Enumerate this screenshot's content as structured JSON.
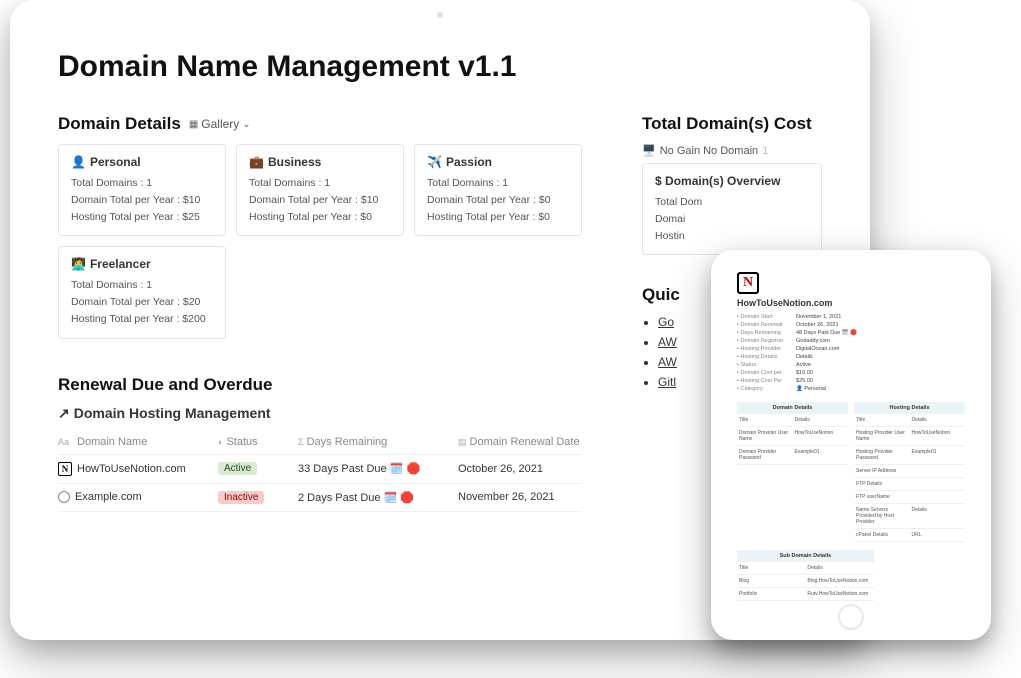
{
  "page": {
    "title": "Domain Name Management v1.1"
  },
  "domain_details": {
    "heading": "Domain Details",
    "view_label": "Gallery",
    "cards": [
      {
        "icon": "👤",
        "title": "Personal",
        "total_domains": "Total Domains : 1",
        "domain_total": "Domain Total per Year : $10",
        "hosting_total": "Hosting Total per Year : $25"
      },
      {
        "icon": "💼",
        "title": "Business",
        "total_domains": "Total Domains : 1",
        "domain_total": "Domain Total per Year : $10",
        "hosting_total": "Hosting Total per Year : $0"
      },
      {
        "icon": "✈️",
        "title": "Passion",
        "total_domains": "Total Domains : 1",
        "domain_total": "Domain Total per Year : $0",
        "hosting_total": "Hosting Total per Year : $0"
      },
      {
        "icon": "🧑‍💻",
        "title": "Freelancer",
        "total_domains": "Total Domains : 1",
        "domain_total": "Domain Total per Year : $20",
        "hosting_total": "Hosting Total per Year : $200"
      }
    ]
  },
  "renewal": {
    "heading": "Renewal Due and Overdue",
    "subheading": "Domain Hosting Management",
    "columns": {
      "name": "Domain Name",
      "status": "Status",
      "days": "Days Remaining",
      "date": "Domain Renewal Date"
    },
    "rows": [
      {
        "icon_type": "notion",
        "name": "HowToUseNotion.com",
        "status": "Active",
        "status_class": "badge-active",
        "days": "33 Days Past Due 🗓️ 🛑",
        "date": "October 26, 2021"
      },
      {
        "icon_type": "globe",
        "name": "Example.com",
        "status": "Inactive",
        "status_class": "badge-inactive",
        "days": "2 Days Past Due 🗓️ 🛑",
        "date": "November 26, 2021"
      }
    ]
  },
  "cost": {
    "heading": "Total Domain(s) Cost",
    "pill": "No Gain No Domain",
    "pill_count": "1",
    "overview_title": "Domain(s) Overview",
    "lines": [
      "Total Dom",
      "Domai",
      "Hostin"
    ]
  },
  "quick": {
    "heading": "Quic",
    "links": [
      "Go",
      "AW",
      "AW",
      "Gitl"
    ]
  },
  "tablet": {
    "title": "HowToUseNotion.com",
    "props": [
      {
        "label": "Domain Start",
        "value": "November 1, 2021"
      },
      {
        "label": "Domain Renewal",
        "value": "October 26, 2021"
      },
      {
        "label": "Days Remaining",
        "value": "48 Days Past Due 🗓️ 🛑"
      },
      {
        "label": "Domain Registrar",
        "value": "Godaddy.com"
      },
      {
        "label": "Hosting Provider",
        "value": "DigitalOcean.com"
      },
      {
        "label": "Hosting Details",
        "value": "Details"
      },
      {
        "label": "Status",
        "value": "Active"
      },
      {
        "label": "Domain Cost per",
        "value": "$10.00"
      },
      {
        "label": "Hosting Cost Per",
        "value": "$25.00"
      },
      {
        "label": "Category",
        "value": "👤 Personal"
      }
    ],
    "domain_table": {
      "header": "Domain Details",
      "rows": [
        {
          "k": "Title",
          "v": "Details"
        },
        {
          "k": "Domain Provider User Name",
          "v": "HowToUseNotion"
        },
        {
          "k": "Domain Provider Password",
          "v": "Example01"
        }
      ]
    },
    "hosting_table": {
      "header": "Hosting Details",
      "rows": [
        {
          "k": "Title",
          "v": "Details"
        },
        {
          "k": "Hosting Provider User Name",
          "v": "HowToUseNotion"
        },
        {
          "k": "Hosting Provider Password",
          "v": "Example01"
        },
        {
          "k": "Server IP Address",
          "v": ""
        },
        {
          "k": "FTP Details",
          "v": ""
        },
        {
          "k": "FTP userName",
          "v": ""
        },
        {
          "k": "Name Servers Provided by Host Provider",
          "v": "Details"
        },
        {
          "k": "cPanel Details",
          "v": "URL"
        }
      ]
    },
    "sub_table": {
      "header": "Sub Domain Details",
      "rows": [
        {
          "k": "Title",
          "v": "Details"
        },
        {
          "k": "Blog",
          "v": "Blog.HowToUseNotion.com"
        },
        {
          "k": "Portfolio",
          "v": "Rutv.HowToUseNotion.com"
        }
      ]
    }
  }
}
